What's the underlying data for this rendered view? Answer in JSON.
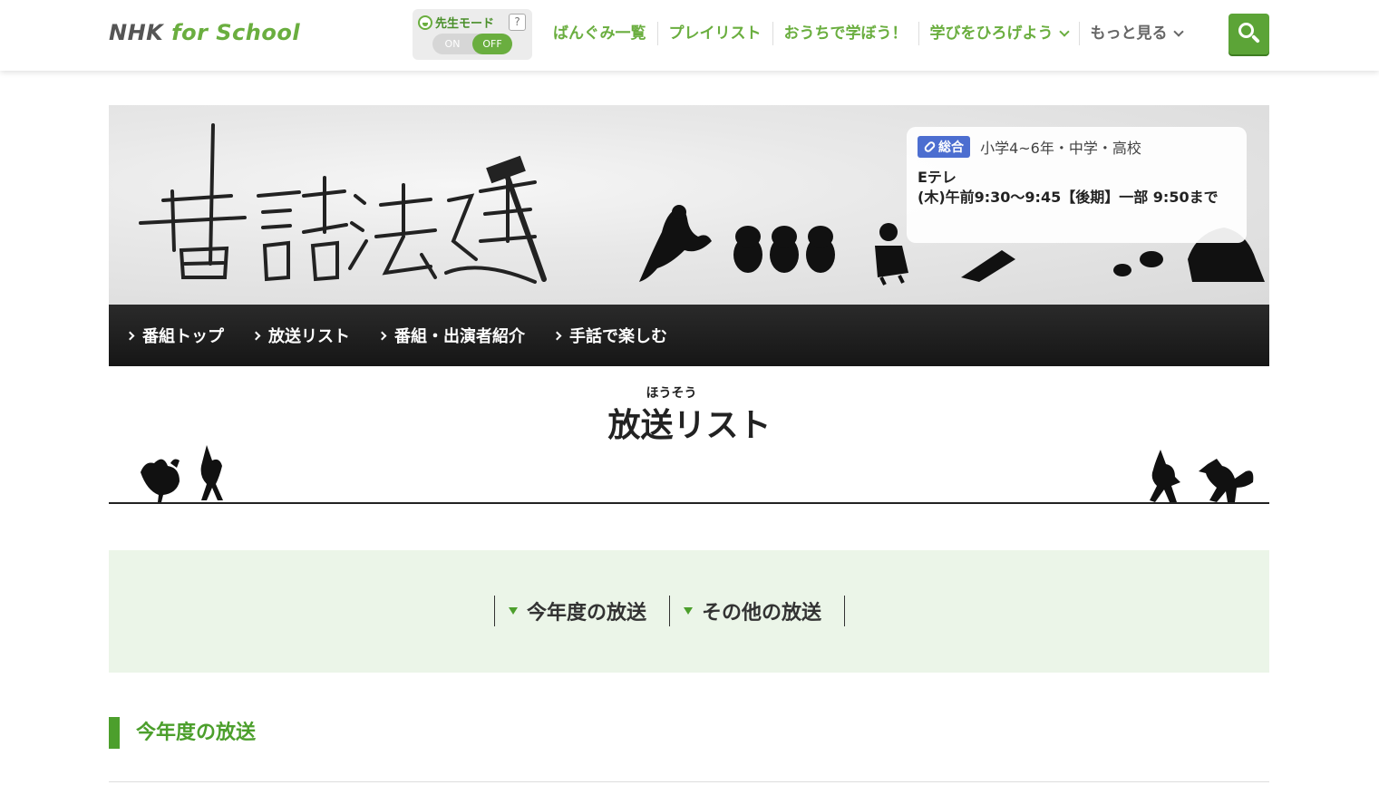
{
  "header": {
    "logo_nhk": "NHK",
    "logo_rest": "for School",
    "teacher_mode_label": "先生モード",
    "help_label": "?",
    "toggle_on": "ON",
    "toggle_off": "OFF",
    "nav": [
      {
        "label": "ばんぐみ一覧"
      },
      {
        "label": "プレイリスト"
      },
      {
        "label": "おうちで学ぼう！"
      },
      {
        "label": "学びをひろげよう"
      },
      {
        "label": "もっと見る"
      }
    ]
  },
  "hero": {
    "program_title": "昔話法廷",
    "badge": "総合",
    "grade": "小学4~6年・中学・高校",
    "channel": "Eテレ",
    "schedule": "(木)午前9:30〜9:45【後期】一部 9:50まで"
  },
  "program_nav": [
    {
      "label": "番組トップ"
    },
    {
      "label": "放送リスト"
    },
    {
      "label": "番組・出演者紹介"
    },
    {
      "label": "手話で楽しむ"
    }
  ],
  "page": {
    "ruby": "ほうそう",
    "title": "放送リスト"
  },
  "anchors": [
    {
      "label": "今年度の放送"
    },
    {
      "label": "その他の放送"
    }
  ],
  "section": {
    "heading": "今年度の放送"
  },
  "colors": {
    "brand_green": "#6aae3f",
    "search_green": "#5ca437",
    "badge_blue": "#4c6ed0",
    "anchor_bg": "#ebf5e8"
  }
}
